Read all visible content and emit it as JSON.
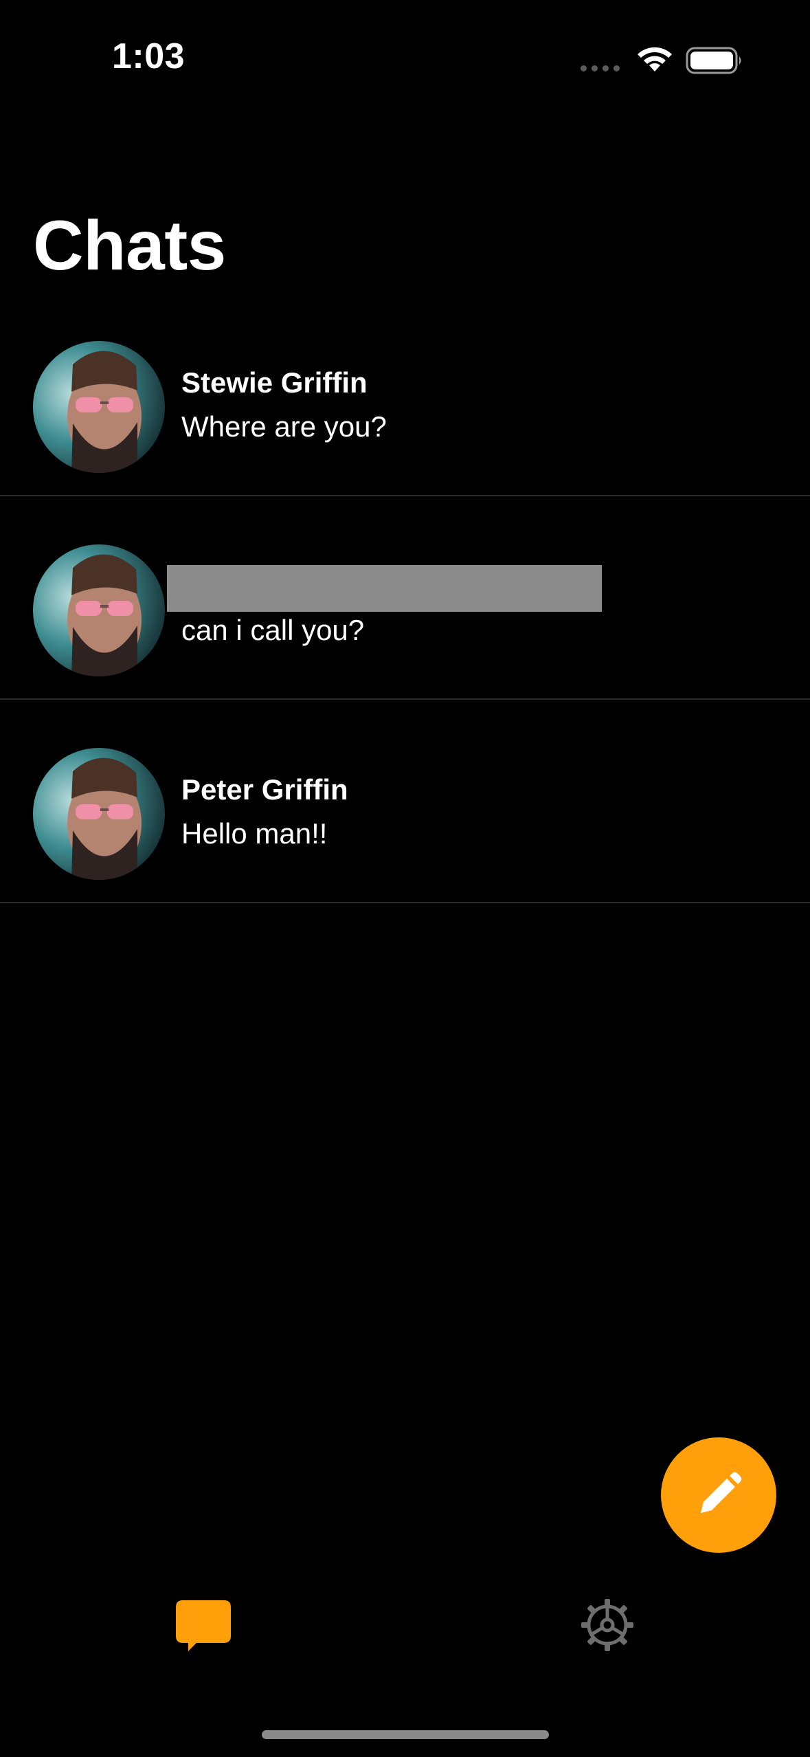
{
  "status_bar": {
    "time": "1:03"
  },
  "header": {
    "title": "Chats"
  },
  "chats": [
    {
      "name": "Stewie Griffin",
      "preview": "Where are you?",
      "name_redacted": false
    },
    {
      "name": "",
      "preview": "can i call you?",
      "name_redacted": true
    },
    {
      "name": "Peter Griffin",
      "preview": "Hello man!!",
      "name_redacted": false
    }
  ],
  "fab": {
    "icon": "pencil-icon",
    "color": "#ff9f0a"
  },
  "tab_bar": {
    "items": [
      {
        "icon": "chat-bubble-icon",
        "active": true,
        "color": "#ff9f0a"
      },
      {
        "icon": "gear-icon",
        "active": false,
        "color": "#6e6e6e"
      }
    ]
  },
  "colors": {
    "background": "#000000",
    "accent": "#ff9f0a",
    "divider": "#2a2a2a",
    "redaction": "#8c8c8c"
  }
}
